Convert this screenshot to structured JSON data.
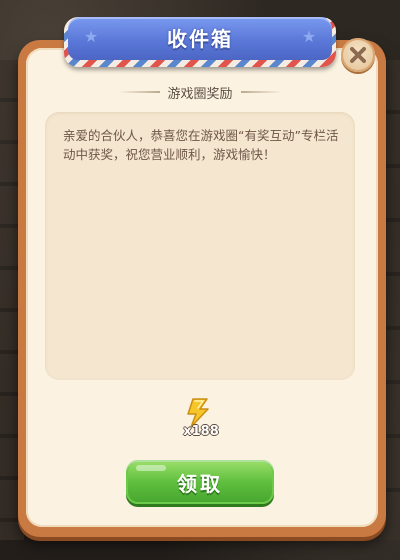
{
  "dialog": {
    "title": "收件箱",
    "subtitle": "游戏圈奖励",
    "message": "亲爱的合伙人，恭喜您在游戏圈“有奖互动”专栏活动中获奖，祝您营业顺利，游戏愉快！"
  },
  "reward": {
    "icon": "lightning-bolt-icon",
    "count_label": "x188"
  },
  "buttons": {
    "claim_label": "领取",
    "close_icon": "close-icon"
  },
  "colors": {
    "banner": "#5b78d8",
    "frame": "#c97a43",
    "panel": "#fbf2e1",
    "claim_button": "#5fbf3e",
    "reward_icon": "#f5c52a"
  }
}
